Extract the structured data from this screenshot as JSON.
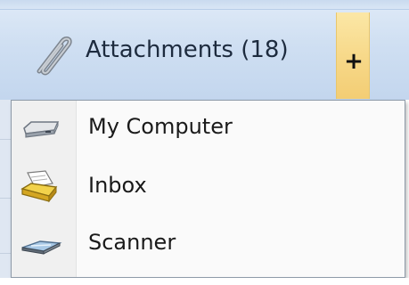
{
  "toolbar": {
    "attachments_label": "Attachments (18)",
    "add_label": "+",
    "attachment_icon": "paperclip-icon",
    "add_button_color": "#f7d98a"
  },
  "menu": {
    "items": [
      {
        "label": "My Computer",
        "icon": "hard-drive-icon"
      },
      {
        "label": "Inbox",
        "icon": "inbox-tray-icon"
      },
      {
        "label": "Scanner",
        "icon": "scanner-icon"
      }
    ]
  }
}
